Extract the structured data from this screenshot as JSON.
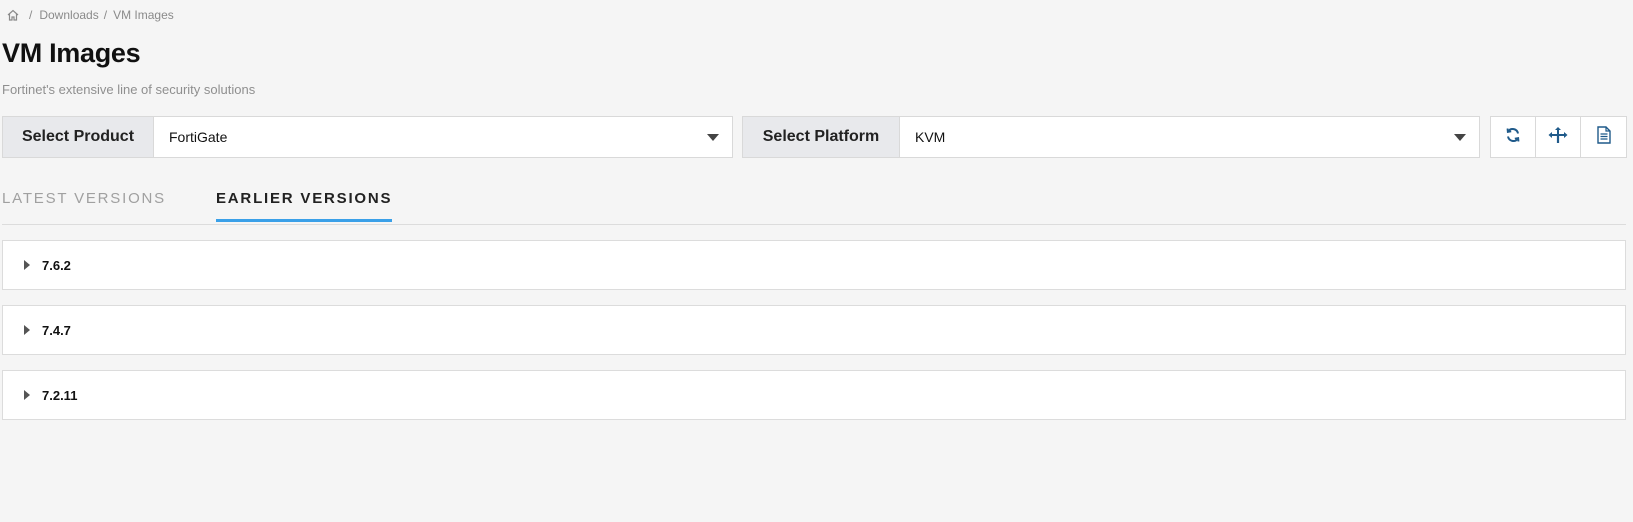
{
  "breadcrumb": {
    "home_icon": "home-icon",
    "separator": "/",
    "items": [
      "Downloads",
      "VM Images"
    ]
  },
  "page": {
    "title": "VM Images",
    "subtitle": "Fortinet's extensive line of security solutions"
  },
  "selectors": {
    "product": {
      "label": "Select Product",
      "value": "FortiGate"
    },
    "platform": {
      "label": "Select Platform",
      "value": "KVM"
    }
  },
  "toolbar": {
    "icons": [
      "refresh-icon",
      "split-arrows-icon",
      "document-icon"
    ],
    "icon_color": "#1f5a8a"
  },
  "tabs": [
    {
      "label": "LATEST VERSIONS",
      "active": false
    },
    {
      "label": "EARLIER VERSIONS",
      "active": true
    }
  ],
  "tab_accent": "#3aa0e8",
  "versions": [
    "7.6.2",
    "7.4.7",
    "7.2.11"
  ]
}
